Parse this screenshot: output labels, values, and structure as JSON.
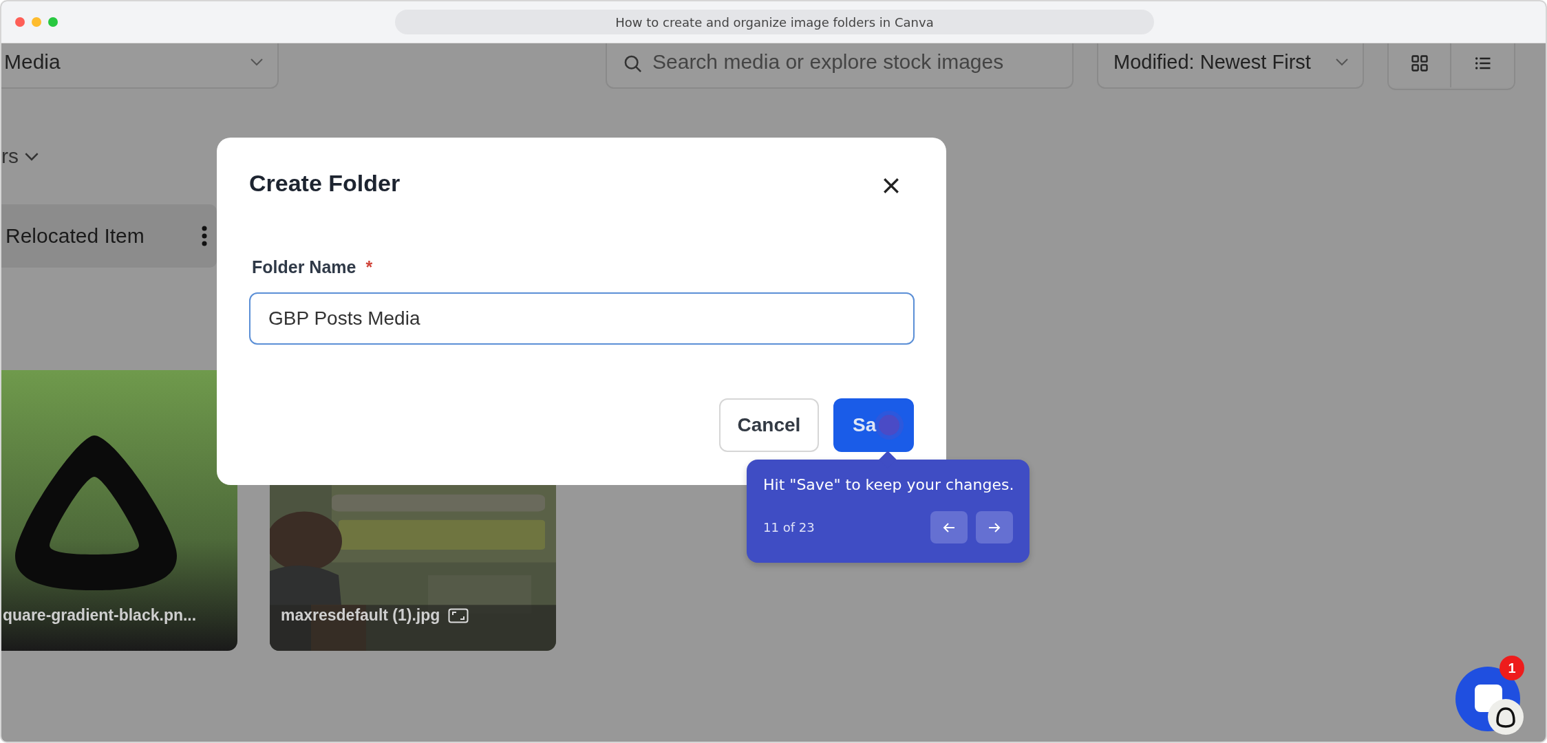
{
  "window": {
    "title": "How to create and organize image folders in Canva"
  },
  "toolbar": {
    "folder_select": "Media",
    "search": {
      "placeholder": "Search media or explore stock images"
    },
    "sort_select": "Modified: Newest First",
    "view_toggle": [
      {
        "kind": "grid"
      },
      {
        "kind": "list"
      }
    ]
  },
  "filter": {
    "label": "rs"
  },
  "folders": [
    {
      "name": "Relocated Item"
    }
  ],
  "files": [
    {
      "name": "quare-gradient-black.pn...",
      "kind": "logo",
      "frame_icon": false
    },
    {
      "name": "maxresdefault (1).jpg",
      "frame_icon": true
    }
  ],
  "dialog": {
    "title": "Create Folder",
    "field": {
      "label": "Folder Name",
      "required_mark": "*",
      "value": "GBP Posts Media"
    },
    "buttons": [
      {
        "label": "Cancel",
        "kind": "secondary"
      },
      {
        "label": "Sa",
        "kind": "primary"
      }
    ]
  },
  "tooltip": {
    "text": "Hit \"Save\" to keep your changes.",
    "step": "11 of 23"
  },
  "chat": {
    "badge": "1"
  }
}
